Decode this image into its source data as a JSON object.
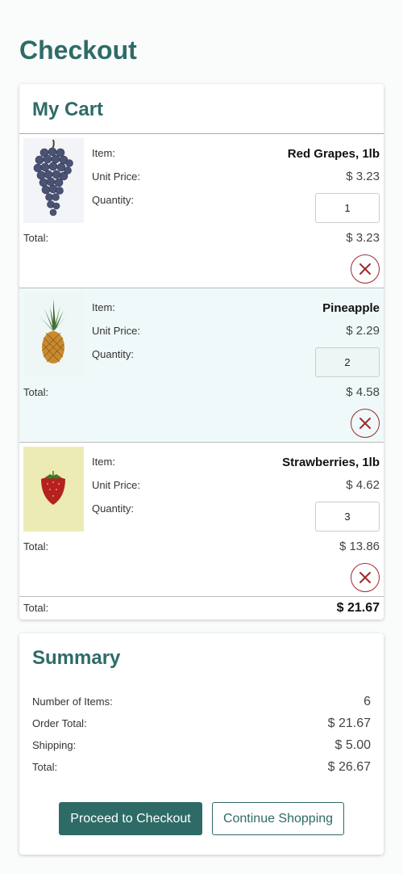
{
  "page": {
    "title": "Checkout"
  },
  "cart": {
    "title": "My Cart",
    "labels": {
      "item": "Item:",
      "unit_price": "Unit Price:",
      "quantity": "Quantity:",
      "total": "Total:"
    },
    "items": [
      {
        "name": "Red Grapes, 1lb",
        "unit_price": "$ 3.23",
        "quantity": "1",
        "total": "$ 3.23",
        "image": "grapes-image"
      },
      {
        "name": "Pineapple",
        "unit_price": "$ 2.29",
        "quantity": "2",
        "total": "$ 4.58",
        "image": "pineapple-image"
      },
      {
        "name": "Strawberries, 1lb",
        "unit_price": "$ 4.62",
        "quantity": "3",
        "total": "$ 13.86",
        "image": "strawberry-image"
      }
    ],
    "remove_icon": "close-x-icon",
    "grand_total_label": "Total:",
    "grand_total": "$ 21.67"
  },
  "summary": {
    "title": "Summary",
    "rows": [
      {
        "label": "Number of Items:",
        "value": "6"
      },
      {
        "label": "Order Total:",
        "value": "$ 21.67"
      },
      {
        "label": "Shipping:",
        "value": "$ 5.00"
      },
      {
        "label": "Total:",
        "value": "$ 26.67"
      }
    ],
    "proceed_label": "Proceed to Checkout",
    "continue_label": "Continue Shopping"
  },
  "colors": {
    "brand": "#2e6b67",
    "remove": "#9e2a2b",
    "alt_row": "#f0f9f9"
  }
}
